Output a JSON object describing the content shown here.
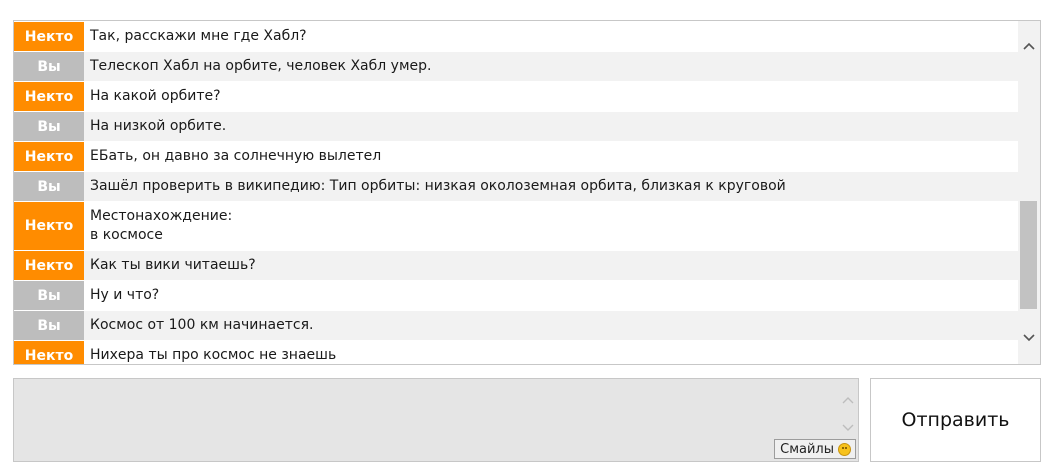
{
  "chat": {
    "messages": [
      {
        "author": "Некто",
        "role": "stranger",
        "text": "Так, расскажи мне где Хабл?"
      },
      {
        "author": "Вы",
        "role": "you",
        "text": "Телескоп Хабл на орбите, человек Хабл умер."
      },
      {
        "author": "Некто",
        "role": "stranger",
        "text": "На какой орбите?"
      },
      {
        "author": "Вы",
        "role": "you",
        "text": "На низкой орбите."
      },
      {
        "author": "Некто",
        "role": "stranger",
        "text": "ЕБать, он давно за солнечную вылетел"
      },
      {
        "author": "Вы",
        "role": "you",
        "text": "Зашёл проверить в википедию: Тип орбиты: низкая околоземная орбита, близкая к круговой"
      },
      {
        "author": "Некто",
        "role": "stranger",
        "text": "Местонахождение:\nв космосе"
      },
      {
        "author": "Некто",
        "role": "stranger",
        "text": "Как ты вики читаешь?"
      },
      {
        "author": "Вы",
        "role": "you",
        "text": "Ну и что?"
      },
      {
        "author": "Вы",
        "role": "you",
        "text": "Космос от 100 км начинается."
      },
      {
        "author": "Некто",
        "role": "stranger",
        "text": "Нихера ты про космос не знаешь"
      }
    ]
  },
  "composer": {
    "value": "",
    "smiles_label": "Смайлы",
    "send_label": "Отправить"
  },
  "colors": {
    "stranger_badge": "#ff8c00",
    "you_badge": "#bdbdbd"
  },
  "icons": {
    "scroll_up": "chevron-up-icon",
    "scroll_down": "chevron-down-icon",
    "smiley": "smiley-icon"
  }
}
